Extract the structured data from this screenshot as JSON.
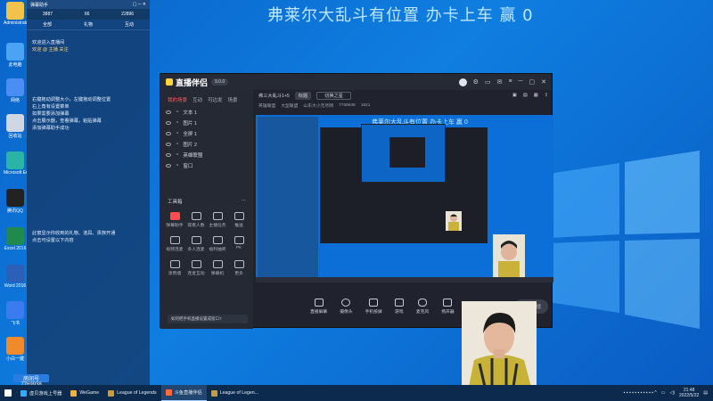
{
  "banner": "弗莱尔大乱斗有位置  办卡上车   赢 0",
  "desktop_icons": [
    {
      "label": "Administrator",
      "color": "#f3c24a"
    },
    {
      "label": "此电脑",
      "color": "#4aa3f3"
    },
    {
      "label": "网络",
      "color": "#4a8df3"
    },
    {
      "label": "回收站",
      "color": "#cfd7e3"
    },
    {
      "label": "Microsoft Edge",
      "color": "#2bb3a6"
    },
    {
      "label": "腾讯QQ",
      "color": "#222222"
    },
    {
      "label": "Excel 2016",
      "color": "#1f8a4c"
    },
    {
      "label": "Word 2016",
      "color": "#2b5fb8"
    },
    {
      "label": "飞书",
      "color": "#3a7bf0"
    },
    {
      "label": "小白一键",
      "color": "#f08a2b"
    }
  ],
  "chat": {
    "header_title": "弹幕助手",
    "stats": [
      "3887",
      "66",
      "22896"
    ],
    "tabs": [
      "全部",
      "礼物",
      "互动"
    ],
    "messages": [
      "欢迎进入直播间",
      "欢迎 @ 主播 关注",
      "右键拖动调整大小，左键拖动调整位置",
      "右上角有设置菜单",
      "如果需要添加弹幕",
      "点击展示器，查看弹幕，粘贴弹幕",
      "添加弹幕助手成功",
      "此窗显示你收到的礼物、道具、贵族开通",
      "点击可设置以下内容"
    ],
    "room_id_label": "房间号",
    "room_id": "7769938"
  },
  "app": {
    "logo": "直播伴侣",
    "version": "9.0.0",
    "side_tabs": [
      "我的场景",
      "互动",
      "可边发",
      "场景"
    ],
    "scenes": [
      "文本 1",
      "图片 1",
      "全屏 1",
      "图片 2",
      "英雄联盟",
      "窗口"
    ],
    "tools_title": "工具箱",
    "tools": [
      "弹幕助手",
      "观看人数",
      "主播任务",
      "推送",
      "视频连麦",
      "多人连麦",
      "福利抽奖",
      "PK",
      "涂鸦墙",
      "连麦互动",
      "弹幕机",
      "更多"
    ],
    "notice": "如何把手机直播设置成窗口?",
    "info_title": "弗三大乱斗1+5",
    "info_pill": "标题",
    "info_input": "切换之星",
    "info_line2": [
      "英雄联盟",
      "大型联盟",
      "山东大小无尽网",
      "7769938",
      "1821"
    ],
    "preview_title": "弗莱尔大乱斗有位置  办卡上车   赢 0",
    "bottom_tools": [
      "直播屏幕",
      "摄像头",
      "手机投屏",
      "游戏",
      "麦克风",
      "扬声器"
    ],
    "start_button": "开始直播"
  },
  "taskbar": {
    "items": [
      {
        "label": "",
        "color": "#3aa0ff"
      },
      {
        "label": "虚贝游戏上号器",
        "color": "#2ab0ff"
      },
      {
        "label": "WeGame",
        "color": "#ffb02e"
      },
      {
        "label": "League of Legends",
        "color": "#c89b3c"
      },
      {
        "label": "斗鱼直播伴侣",
        "color": "#ff6a3d"
      },
      {
        "label": "League of Legen...",
        "color": "#c89b3c"
      }
    ],
    "time": "21:48",
    "date": "2022/5/22"
  }
}
